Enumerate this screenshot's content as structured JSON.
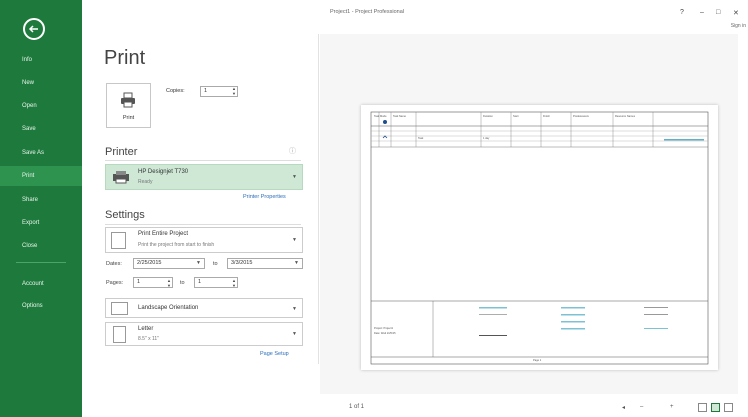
{
  "window": {
    "title": "Project1 - Project Professional",
    "help": "?",
    "minimize": "–",
    "restore": "□",
    "close": "✕",
    "sign_in": "Sign in"
  },
  "sidebar": {
    "items": [
      {
        "label": "Info",
        "active": false
      },
      {
        "label": "New",
        "active": false
      },
      {
        "label": "Open",
        "active": false
      },
      {
        "label": "Save",
        "active": false
      },
      {
        "label": "Save As",
        "active": false
      },
      {
        "label": "Print",
        "active": true
      },
      {
        "label": "Share",
        "active": false
      },
      {
        "label": "Export",
        "active": false
      },
      {
        "label": "Close",
        "active": false
      },
      {
        "label": "Account",
        "active": false
      },
      {
        "label": "Options",
        "active": false
      }
    ]
  },
  "print": {
    "heading": "Print",
    "print_button": "Print",
    "copies_label": "Copies:",
    "copies_value": "1"
  },
  "printer": {
    "heading": "Printer",
    "name": "HP Designjet T730",
    "status": "Ready",
    "properties_link": "Printer Properties"
  },
  "settings": {
    "heading": "Settings",
    "scope_title": "Print Entire Project",
    "scope_desc": "Print the project from start to finish",
    "dates_label": "Dates:",
    "date_from": "2/25/2015",
    "to1": "to",
    "date_to": "3/3/2015",
    "pages_label": "Pages:",
    "page_from": "1",
    "to2": "to",
    "page_to": "1",
    "orientation": "Landscape Orientation",
    "paper_name": "Letter",
    "paper_size": "8.5\" x 11\"",
    "page_setup_link": "Page Setup"
  },
  "preview": {
    "page_indicator": "1 of 1",
    "columns": [
      "Task Mode",
      "Task Name",
      "Duration",
      "Start",
      "Finish",
      "Predecessors",
      "Resource Names"
    ],
    "row_task": "Task",
    "row_duration": "1 day",
    "legend_project": "Project: Project1",
    "legend_date": "Date: Wed 2/25/15",
    "footer": "Page 1"
  }
}
